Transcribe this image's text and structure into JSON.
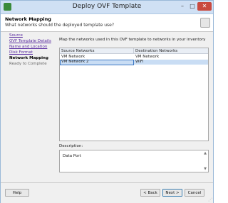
{
  "window": {
    "title": "Deploy OVF Template",
    "min": "–",
    "max": "□",
    "close": "✕"
  },
  "header": {
    "title": "Network Mapping",
    "subtitle": "What networks should the deployed template use?"
  },
  "nav": [
    {
      "label": "Source",
      "state": "link"
    },
    {
      "label": "OVF Template Details",
      "state": "link"
    },
    {
      "label": "Name and Location",
      "state": "link"
    },
    {
      "label": "Disk Format",
      "state": "link"
    },
    {
      "label": "Network Mapping",
      "state": "active"
    },
    {
      "label": "Ready to Complete",
      "state": "disabled"
    }
  ],
  "main": {
    "instruction": "Map the networks used in this OVF template to networks in your inventory",
    "columns": [
      "Source Networks",
      "Destination Networks"
    ],
    "rows": [
      {
        "source": "VM Network",
        "destination": "VM Network"
      },
      {
        "source": "VM Network 2",
        "destination": "WiFi"
      }
    ],
    "description_label": "Description:",
    "description_text": "Data Port"
  },
  "footer": {
    "help": "Help",
    "back": "< Back",
    "next": "Next >",
    "cancel": "Cancel"
  },
  "colors": {
    "selection": "#c9ddf4",
    "titlebar": "#cfe0f4",
    "close": "#c94a3f",
    "link": "#5a2ca0"
  }
}
